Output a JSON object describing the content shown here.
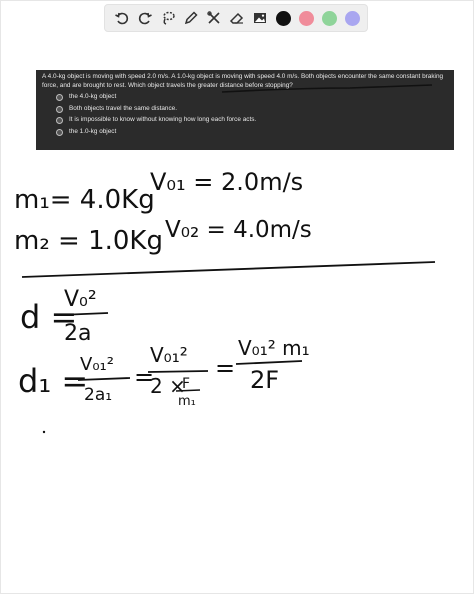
{
  "toolbar": {
    "tools": [
      {
        "name": "undo-icon"
      },
      {
        "name": "redo-icon"
      },
      {
        "name": "lasso-icon"
      },
      {
        "name": "pen-icon"
      },
      {
        "name": "tools-icon"
      },
      {
        "name": "eraser-icon"
      },
      {
        "name": "image-icon"
      }
    ],
    "colors": [
      "#111111",
      "#f08c9a",
      "#8fd49a",
      "#a9a6f0"
    ]
  },
  "question": {
    "text": "A 4.0-kg object is moving with speed 2.0 m/s. A 1.0-kg object is moving with speed 4.0 m/s. Both objects encounter the same constant braking force, and are brought to rest. Which object travels the greater distance before stopping?",
    "options": [
      "the 4.0-kg object",
      "Both objects travel the same distance.",
      "It is impossible to know without knowing how long each force acts.",
      "the 1.0-kg object"
    ]
  },
  "notes": {
    "m1": "m₁= 4.0Kg",
    "v01": "V₀₁ = 2.0m/s",
    "m2": "m₂ = 1.0Kg",
    "v02": "V₀₂ = 4.0m/s",
    "d_lhs": "d =",
    "d_num": "V₀²",
    "d_den": "2a",
    "d1_lhs": "d₁ =",
    "d1_f1_num": "V₀₁²",
    "d1_f1_den": "2a₁",
    "eq": "=",
    "d1_f2_num": "V₀₁²",
    "d1_f2_den_pre": "2 ×",
    "d1_f2_F": "F",
    "d1_f2_m": "m₁",
    "d1_f3_num": "V₀₁² m₁",
    "d1_f3_den": "2F"
  }
}
